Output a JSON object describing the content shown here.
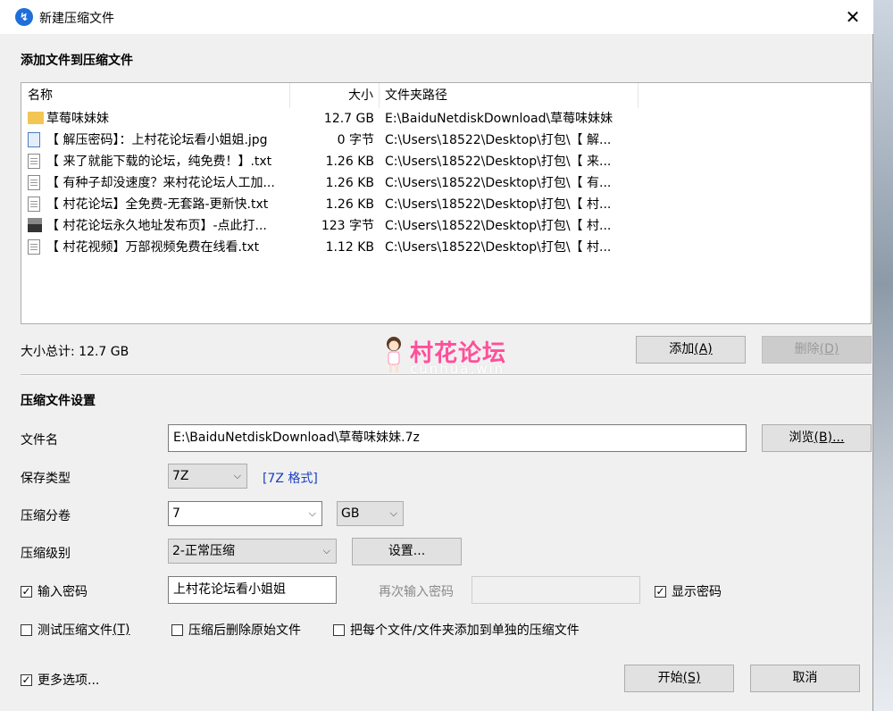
{
  "window": {
    "title": "新建压缩文件",
    "icon": "app-logo-icon",
    "close_glyph": "✕"
  },
  "add_section": {
    "title": "添加文件到压缩文件"
  },
  "file_list": {
    "headers": {
      "name": "名称",
      "size": "大小",
      "path": "文件夹路径"
    },
    "rows": [
      {
        "icon": "folder-icon",
        "name": "草莓味妹妹",
        "size": "12.7 GB",
        "path": "E:\\BaiduNetdiskDownload\\草莓味妹妹"
      },
      {
        "icon": "image-file-icon",
        "name": "【 解压密码】：上村花论坛看小姐姐.jpg",
        "size": "0 字节",
        "path": "C:\\Users\\18522\\Desktop\\打包\\【 解..."
      },
      {
        "icon": "text-file-icon",
        "name": "【 来了就能下载的论坛，纯免费！】.txt",
        "size": "1.26 KB",
        "path": "C:\\Users\\18522\\Desktop\\打包\\【 来..."
      },
      {
        "icon": "text-file-icon",
        "name": "【 有种子却没速度？来村花论坛人工加...",
        "size": "1.26 KB",
        "path": "C:\\Users\\18522\\Desktop\\打包\\【 有..."
      },
      {
        "icon": "text-file-icon",
        "name": "【 村花论坛】全免费-无套路-更新快.txt",
        "size": "1.26 KB",
        "path": "C:\\Users\\18522\\Desktop\\打包\\【 村..."
      },
      {
        "icon": "url-file-icon",
        "name": "【 村花论坛永久地址发布页】-点此打...",
        "size": "123 字节",
        "path": "C:\\Users\\18522\\Desktop\\打包\\【 村..."
      },
      {
        "icon": "text-file-icon",
        "name": "【 村花视频】万部视频免费在线看.txt",
        "size": "1.12 KB",
        "path": "C:\\Users\\18522\\Desktop\\打包\\【 村..."
      }
    ]
  },
  "total_size": "大小总计: 12.7 GB",
  "watermark": {
    "text": "村花论坛",
    "sub": "cunhua.win"
  },
  "buttons": {
    "add": {
      "label": "添加",
      "key": "(A)"
    },
    "delete": {
      "label": "删除",
      "key": "(D)"
    },
    "browse": {
      "label": "浏览",
      "key": "(B)..."
    },
    "settings": {
      "label": "设置..."
    },
    "start": {
      "label": "开始",
      "key": "(S)"
    },
    "cancel": {
      "label": "取消"
    }
  },
  "settings_section": {
    "title": "压缩文件设置"
  },
  "filename": {
    "label": "文件名",
    "value": "E:\\BaiduNetdiskDownload\\草莓味妹妹.7z"
  },
  "save_type": {
    "label": "保存类型",
    "value": "7Z",
    "link": "[7Z 格式]"
  },
  "split": {
    "label": "压缩分卷",
    "value": "7",
    "unit": "GB"
  },
  "level": {
    "label": "压缩级别",
    "value": "2-正常压缩"
  },
  "password": {
    "enable_label": "输入密码",
    "enabled": true,
    "value": "上村花论坛看小姐姐",
    "confirm_label": "再次输入密码",
    "confirm_value": "",
    "show_label": "显示密码",
    "show": true
  },
  "options": {
    "test": {
      "label": "测试压缩文件",
      "key": "(T)",
      "checked": false
    },
    "delete_after": {
      "label": "压缩后删除原始文件",
      "checked": false
    },
    "separate": {
      "label": "把每个文件/文件夹添加到单独的压缩文件",
      "checked": false
    },
    "more": {
      "label": "更多选项...",
      "checked": true
    }
  },
  "glyphs": {
    "check": "✓",
    "dropdown": "⌵"
  }
}
